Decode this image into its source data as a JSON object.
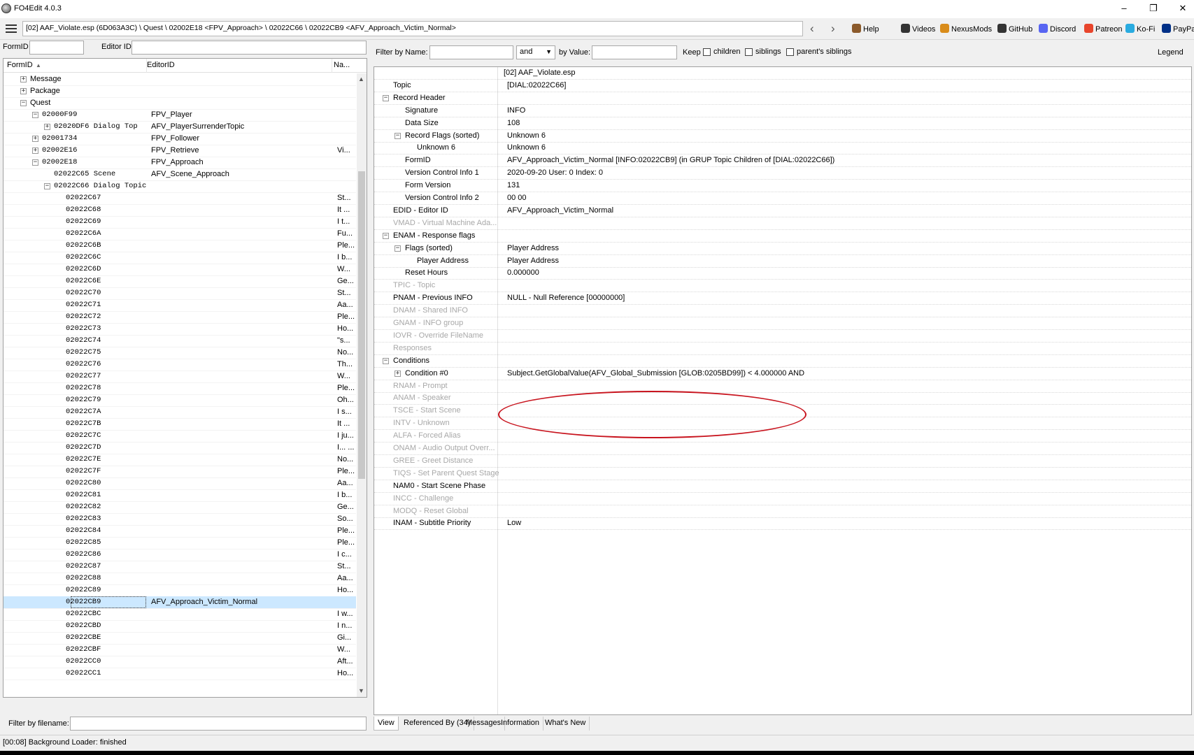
{
  "window": {
    "title": "FO4Edit 4.0.3",
    "minimize": "–",
    "restore": "❐",
    "close": "✕"
  },
  "toolbar": {
    "path": "[02] AAF_Violate.esp (6D063A3C) \\ Quest \\ 02002E18 <FPV_Approach> \\ 02022C66 \\ 02022CB9 <AFV_Approach_Victim_Normal>",
    "back": "‹",
    "forward": "›",
    "links": [
      {
        "label": "Help",
        "icon": "book-icon",
        "color": "#8b5a2b"
      },
      {
        "label": "Videos",
        "icon": "film-icon",
        "color": "#333333"
      },
      {
        "label": "NexusMods",
        "icon": "nexus-icon",
        "color": "#d98c1a"
      },
      {
        "label": "GitHub",
        "icon": "github-icon",
        "color": "#333333"
      },
      {
        "label": "Discord",
        "icon": "discord-icon",
        "color": "#5865f2"
      },
      {
        "label": "Patreon",
        "icon": "patreon-icon",
        "color": "#e8452c"
      },
      {
        "label": "Ko-Fi",
        "icon": "kofi-icon",
        "color": "#29abe0"
      },
      {
        "label": "PayPal",
        "icon": "paypal-icon",
        "color": "#003087"
      }
    ]
  },
  "left": {
    "formid_label": "FormID",
    "editorid_label": "Editor ID",
    "columns": [
      "FormID",
      "EditorID",
      "Na..."
    ],
    "sort_indicator": "▲",
    "filter_label": "Filter by filename:",
    "rows": [
      {
        "id": "Message",
        "edid": "",
        "name": "",
        "indent": 0,
        "exp": "+",
        "text": true
      },
      {
        "id": "Package",
        "edid": "",
        "name": "",
        "indent": 0,
        "exp": "+",
        "text": true
      },
      {
        "id": "Quest",
        "edid": "",
        "name": "",
        "indent": 0,
        "exp": "−",
        "text": true
      },
      {
        "id": "02000F99",
        "edid": "FPV_Player",
        "name": "",
        "indent": 1,
        "exp": "−"
      },
      {
        "id": "02020DF6 Dialog Top",
        "edid": "AFV_PlayerSurrenderTopic",
        "name": "",
        "indent": 2,
        "exp": "+"
      },
      {
        "id": "02001734",
        "edid": "FPV_Follower",
        "name": "",
        "indent": 1,
        "exp": "+"
      },
      {
        "id": "02002E16",
        "edid": "FPV_Retrieve",
        "name": "Vi...",
        "indent": 1,
        "exp": "+"
      },
      {
        "id": "02002E18",
        "edid": "FPV_Approach",
        "name": "",
        "indent": 1,
        "exp": "−"
      },
      {
        "id": "02022C65 Scene",
        "edid": "AFV_Scene_Approach",
        "name": "",
        "indent": 2,
        "exp": ""
      },
      {
        "id": "02022C66 Dialog Topic",
        "edid": "",
        "name": "",
        "indent": 2,
        "exp": "−"
      },
      {
        "id": "02022C67",
        "edid": "",
        "name": "St...",
        "indent": 3,
        "exp": ""
      },
      {
        "id": "02022C68",
        "edid": "",
        "name": "It ...",
        "indent": 3,
        "exp": ""
      },
      {
        "id": "02022C69",
        "edid": "",
        "name": "I t...",
        "indent": 3,
        "exp": ""
      },
      {
        "id": "02022C6A",
        "edid": "",
        "name": "Fu...",
        "indent": 3,
        "exp": ""
      },
      {
        "id": "02022C6B",
        "edid": "",
        "name": "Ple...",
        "indent": 3,
        "exp": ""
      },
      {
        "id": "02022C6C",
        "edid": "",
        "name": "I b...",
        "indent": 3,
        "exp": ""
      },
      {
        "id": "02022C6D",
        "edid": "",
        "name": "W...",
        "indent": 3,
        "exp": ""
      },
      {
        "id": "02022C6E",
        "edid": "",
        "name": "Ge...",
        "indent": 3,
        "exp": ""
      },
      {
        "id": "02022C70",
        "edid": "",
        "name": "St...",
        "indent": 3,
        "exp": ""
      },
      {
        "id": "02022C71",
        "edid": "",
        "name": "Aa...",
        "indent": 3,
        "exp": ""
      },
      {
        "id": "02022C72",
        "edid": "",
        "name": "Ple...",
        "indent": 3,
        "exp": ""
      },
      {
        "id": "02022C73",
        "edid": "",
        "name": "Ho...",
        "indent": 3,
        "exp": ""
      },
      {
        "id": "02022C74",
        "edid": "",
        "name": "\"s...",
        "indent": 3,
        "exp": ""
      },
      {
        "id": "02022C75",
        "edid": "",
        "name": "No...",
        "indent": 3,
        "exp": ""
      },
      {
        "id": "02022C76",
        "edid": "",
        "name": "Th...",
        "indent": 3,
        "exp": ""
      },
      {
        "id": "02022C77",
        "edid": "",
        "name": "W...",
        "indent": 3,
        "exp": ""
      },
      {
        "id": "02022C78",
        "edid": "",
        "name": "Ple...",
        "indent": 3,
        "exp": ""
      },
      {
        "id": "02022C79",
        "edid": "",
        "name": "Oh...",
        "indent": 3,
        "exp": ""
      },
      {
        "id": "02022C7A",
        "edid": "",
        "name": "I s...",
        "indent": 3,
        "exp": ""
      },
      {
        "id": "02022C7B",
        "edid": "",
        "name": "It ...",
        "indent": 3,
        "exp": ""
      },
      {
        "id": "02022C7C",
        "edid": "",
        "name": "I ju...",
        "indent": 3,
        "exp": ""
      },
      {
        "id": "02022C7D",
        "edid": "",
        "name": "I... ...",
        "indent": 3,
        "exp": ""
      },
      {
        "id": "02022C7E",
        "edid": "",
        "name": "No...",
        "indent": 3,
        "exp": ""
      },
      {
        "id": "02022C7F",
        "edid": "",
        "name": "Ple...",
        "indent": 3,
        "exp": ""
      },
      {
        "id": "02022C80",
        "edid": "",
        "name": "Aa...",
        "indent": 3,
        "exp": ""
      },
      {
        "id": "02022C81",
        "edid": "",
        "name": "I b...",
        "indent": 3,
        "exp": ""
      },
      {
        "id": "02022C82",
        "edid": "",
        "name": "Ge...",
        "indent": 3,
        "exp": ""
      },
      {
        "id": "02022C83",
        "edid": "",
        "name": "So...",
        "indent": 3,
        "exp": ""
      },
      {
        "id": "02022C84",
        "edid": "",
        "name": "Ple...",
        "indent": 3,
        "exp": ""
      },
      {
        "id": "02022C85",
        "edid": "",
        "name": "Ple...",
        "indent": 3,
        "exp": ""
      },
      {
        "id": "02022C86",
        "edid": "",
        "name": "I c...",
        "indent": 3,
        "exp": ""
      },
      {
        "id": "02022C87",
        "edid": "",
        "name": "St...",
        "indent": 3,
        "exp": ""
      },
      {
        "id": "02022C88",
        "edid": "",
        "name": "Aa...",
        "indent": 3,
        "exp": ""
      },
      {
        "id": "02022C89",
        "edid": "",
        "name": "Ho...",
        "indent": 3,
        "exp": ""
      },
      {
        "id": "02022CB9",
        "edid": "AFV_Approach_Victim_Normal",
        "name": "",
        "indent": 3,
        "exp": "",
        "selected": true
      },
      {
        "id": "02022CBC",
        "edid": "",
        "name": "I w...",
        "indent": 3,
        "exp": ""
      },
      {
        "id": "02022CBD",
        "edid": "",
        "name": "I n...",
        "indent": 3,
        "exp": ""
      },
      {
        "id": "02022CBE",
        "edid": "",
        "name": "Gi...",
        "indent": 3,
        "exp": ""
      },
      {
        "id": "02022CBF",
        "edid": "",
        "name": "W...",
        "indent": 3,
        "exp": ""
      },
      {
        "id": "02022CC0",
        "edid": "",
        "name": "Aft...",
        "indent": 3,
        "exp": ""
      },
      {
        "id": "02022CC1",
        "edid": "",
        "name": "Ho...",
        "indent": 3,
        "exp": ""
      }
    ]
  },
  "right": {
    "filter_name_label": "Filter by Name:",
    "and_select": "and",
    "by_value_label": "by Value:",
    "keep_label": "Keep",
    "children_label": "children",
    "siblings_label": "siblings",
    "parents_siblings_label": "parent's siblings",
    "legend_label": "Legend",
    "file_header": "[02] AAF_Violate.esp",
    "rows": [
      {
        "k": "Topic",
        "v": "[DIAL:02022C66]",
        "indent": 0,
        "exp": "",
        "gray": false
      },
      {
        "k": "Record Header",
        "v": "",
        "indent": 0,
        "exp": "−",
        "gray": false
      },
      {
        "k": "Signature",
        "v": "INFO",
        "indent": 1,
        "exp": "",
        "gray": false
      },
      {
        "k": "Data Size",
        "v": "108",
        "indent": 1,
        "exp": "",
        "gray": false
      },
      {
        "k": "Record Flags (sorted)",
        "v": "Unknown 6",
        "indent": 1,
        "exp": "−",
        "gray": false
      },
      {
        "k": "Unknown 6",
        "v": "Unknown 6",
        "indent": 2,
        "exp": "",
        "gray": false
      },
      {
        "k": "FormID",
        "v": "AFV_Approach_Victim_Normal [INFO:02022CB9] (in GRUP Topic Children of [DIAL:02022C66])",
        "indent": 1,
        "exp": "",
        "gray": false
      },
      {
        "k": "Version Control Info 1",
        "v": "2020-09-20 User: 0 Index: 0",
        "indent": 1,
        "exp": "",
        "gray": false
      },
      {
        "k": "Form Version",
        "v": "131",
        "indent": 1,
        "exp": "",
        "gray": false
      },
      {
        "k": "Version Control Info 2",
        "v": "00 00",
        "indent": 1,
        "exp": "",
        "gray": false
      },
      {
        "k": "EDID - Editor ID",
        "v": "AFV_Approach_Victim_Normal",
        "indent": 0,
        "exp": "",
        "gray": false
      },
      {
        "k": "VMAD - Virtual Machine Ada...",
        "v": "",
        "indent": 0,
        "exp": "",
        "gray": true
      },
      {
        "k": "ENAM - Response flags",
        "v": "",
        "indent": 0,
        "exp": "−",
        "gray": false
      },
      {
        "k": "Flags (sorted)",
        "v": "Player Address",
        "indent": 1,
        "exp": "−",
        "gray": false
      },
      {
        "k": "Player Address",
        "v": "Player Address",
        "indent": 2,
        "exp": "",
        "gray": false
      },
      {
        "k": "Reset Hours",
        "v": "0.000000",
        "indent": 1,
        "exp": "",
        "gray": false
      },
      {
        "k": "TPIC - Topic",
        "v": "",
        "indent": 0,
        "exp": "",
        "gray": true
      },
      {
        "k": "PNAM - Previous INFO",
        "v": "NULL - Null Reference [00000000]",
        "indent": 0,
        "exp": "",
        "gray": false
      },
      {
        "k": "DNAM - Shared INFO",
        "v": "",
        "indent": 0,
        "exp": "",
        "gray": true
      },
      {
        "k": "GNAM - INFO group",
        "v": "",
        "indent": 0,
        "exp": "",
        "gray": true
      },
      {
        "k": "IOVR - Override FileName",
        "v": "",
        "indent": 0,
        "exp": "",
        "gray": true
      },
      {
        "k": "Responses",
        "v": "",
        "indent": 0,
        "exp": "",
        "gray": true
      },
      {
        "k": "Conditions",
        "v": "",
        "indent": 0,
        "exp": "−",
        "gray": false
      },
      {
        "k": "Condition #0",
        "v": "Subject.GetGlobalValue(AFV_Global_Submission [GLOB:0205BD99]) < 4.000000 AND",
        "indent": 1,
        "exp": "+",
        "gray": false
      },
      {
        "k": "RNAM - Prompt",
        "v": "",
        "indent": 0,
        "exp": "",
        "gray": true
      },
      {
        "k": "ANAM - Speaker",
        "v": "",
        "indent": 0,
        "exp": "",
        "gray": true
      },
      {
        "k": "TSCE - Start Scene",
        "v": "",
        "indent": 0,
        "exp": "",
        "gray": true
      },
      {
        "k": "INTV - Unknown",
        "v": "",
        "indent": 0,
        "exp": "",
        "gray": true
      },
      {
        "k": "ALFA - Forced Alias",
        "v": "",
        "indent": 0,
        "exp": "",
        "gray": true
      },
      {
        "k": "ONAM - Audio Output Overr...",
        "v": "",
        "indent": 0,
        "exp": "",
        "gray": true
      },
      {
        "k": "GREE - Greet Distance",
        "v": "",
        "indent": 0,
        "exp": "",
        "gray": true
      },
      {
        "k": "TIQS - Set Parent Quest Stage",
        "v": "",
        "indent": 0,
        "exp": "",
        "gray": true
      },
      {
        "k": "NAM0 - Start Scene Phase",
        "v": "",
        "indent": 0,
        "exp": "",
        "gray": false
      },
      {
        "k": "INCC - Challenge",
        "v": "",
        "indent": 0,
        "exp": "",
        "gray": true
      },
      {
        "k": "MODQ - Reset Global",
        "v": "",
        "indent": 0,
        "exp": "",
        "gray": true
      },
      {
        "k": "INAM - Subtitle Priority",
        "v": "Low",
        "indent": 0,
        "exp": "",
        "gray": false
      }
    ],
    "tabs": [
      "View",
      "Referenced By (34)",
      "Messages",
      "Information",
      "What's New"
    ]
  },
  "status": "[00:08] Background Loader: finished"
}
